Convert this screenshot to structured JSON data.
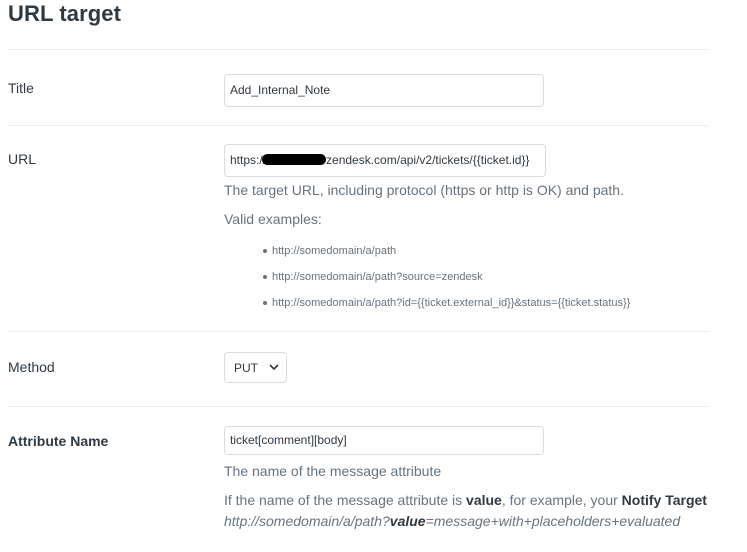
{
  "page": {
    "title": "URL target"
  },
  "title_field": {
    "label": "Title",
    "value": "Add_Internal_Note"
  },
  "url_field": {
    "label": "URL",
    "value_prefix": "https://",
    "value_suffix": "zendesk.com/api/v2/tickets/{{ticket.id}}",
    "hint": "The target URL, including protocol (https or http is OK) and path.",
    "examples_label": "Valid examples:",
    "examples": [
      "http://somedomain/a/path",
      "http://somedomain/a/path?source=zendesk",
      "http://somedomain/a/path?id={{ticket.external_id}}&status={{ticket.status}}"
    ]
  },
  "method_field": {
    "label": "Method",
    "selected": "PUT",
    "icon": "chevron-down-icon"
  },
  "attribute_field": {
    "label": "Attribute Name",
    "value": "ticket[comment][body]",
    "hint": "The name of the message attribute",
    "help_part1": "If the name of the message attribute is ",
    "help_bold_value": "value",
    "help_part2": ", for example, your ",
    "help_bold_notify": "Notify Target",
    "help_url_prefix": "http://somedomain/a/path?",
    "help_url_value": "value",
    "help_url_suffix": "=message+with+placeholders+evaluated"
  },
  "colors": {
    "text": "#2f3941",
    "muted": "#68737d",
    "border": "#d8dcde",
    "divider": "#eceeef"
  }
}
